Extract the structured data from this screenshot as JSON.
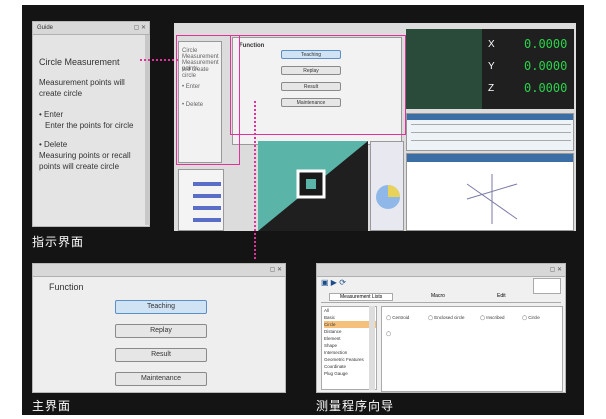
{
  "guide_panel": {
    "title": "Guide",
    "heading": "Circle Measurement",
    "desc": "Measurement points will create circle",
    "bullet1_title": "Enter",
    "bullet1_body": "Enter the points for circle",
    "bullet2_title": "Delete",
    "bullet2_body": "Measuring points or recall points will create circle"
  },
  "main_panel": {
    "title": "Function",
    "buttons": [
      "Teaching",
      "Replay",
      "Result",
      "Maintenance"
    ]
  },
  "wizard": {
    "tabs": [
      "Measurement Lists",
      "Macro",
      "Edit"
    ],
    "list": [
      "All",
      "Basic",
      "Circle",
      "Distance",
      "Element",
      "Shape",
      "Intersection",
      "Geometric Features",
      "Coordinate",
      "Plug Gauge"
    ],
    "items": [
      "Centroid",
      "Enclosed circle",
      "Inscribed",
      "Circle"
    ]
  },
  "dro": {
    "x_value": "0.0000",
    "y_value": "0.0000",
    "z_value": "0.0000"
  },
  "captions": {
    "guide": "指示界面",
    "main": "主界面",
    "wizard": "测量程序向导"
  },
  "colors": {
    "highlight": "#e0339a",
    "button_active": "#cfe3f5",
    "dro_text": "#2ad24a"
  }
}
